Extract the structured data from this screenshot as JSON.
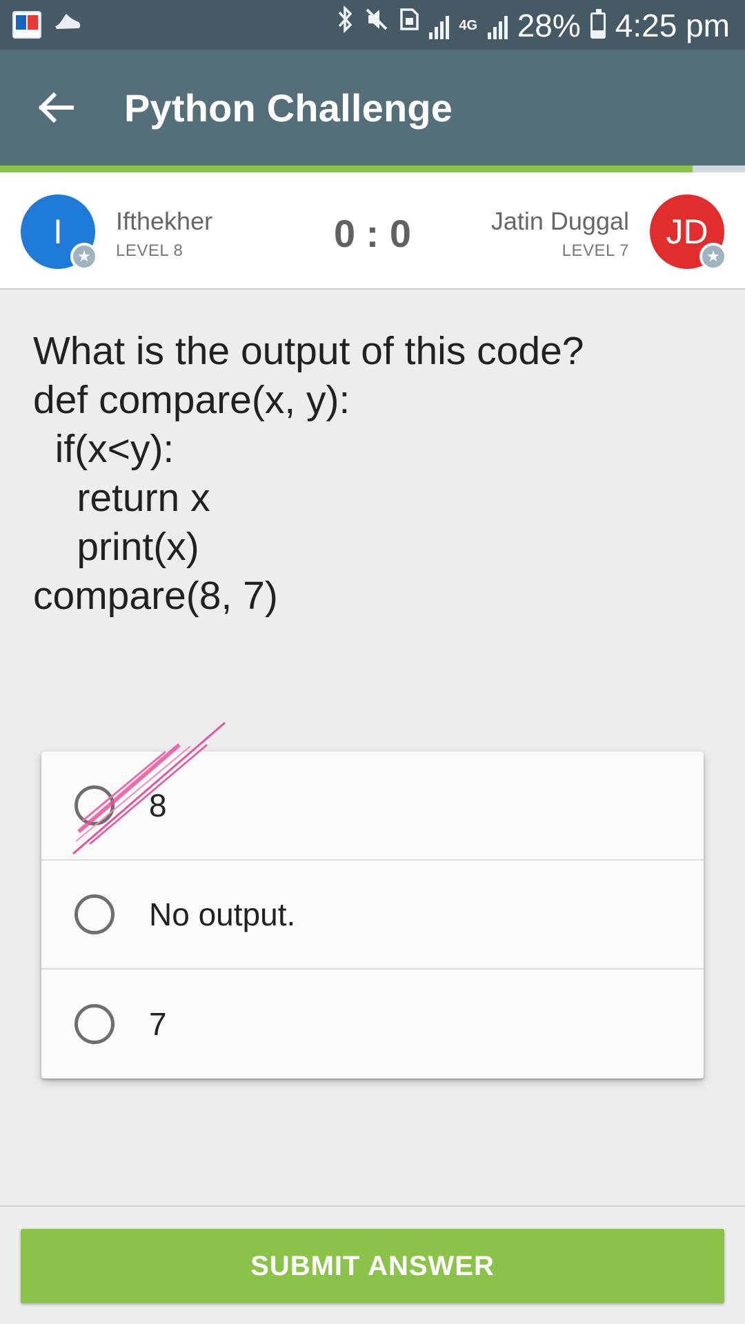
{
  "status_bar": {
    "left_icons": [
      "book-app-icon",
      "shoe-icon"
    ],
    "right_icons": [
      "bluetooth-icon",
      "mute-icon",
      "sim-icon",
      "signal-icon",
      "4g-icon",
      "signal-icon"
    ],
    "network_label": "4G",
    "battery": "28%",
    "battery_level": 0.28,
    "time": "4:25 pm"
  },
  "app_bar": {
    "title": "Python Challenge",
    "back_icon": "arrow-left-icon",
    "progress": 0.93,
    "progress_color": "#8bc34a"
  },
  "players": {
    "left": {
      "initial": "I",
      "name": "Ifthekher",
      "level": "LEVEL 8",
      "color": "#1e7ad6"
    },
    "right": {
      "initial": "JD",
      "name": "Jatin Duggal",
      "level": "LEVEL 7",
      "color": "#e12d2d"
    },
    "score": "0 : 0"
  },
  "question": {
    "lines": [
      "What is the output of this code?",
      "def compare(x, y):",
      "  if(x<y):",
      "    return x",
      "    print(x)",
      "compare(8, 7)"
    ]
  },
  "options": [
    {
      "label": "8"
    },
    {
      "label": "No output."
    },
    {
      "label": "7"
    }
  ],
  "submit": {
    "label": "SUBMIT ANSWER",
    "color": "#8bc34a"
  }
}
